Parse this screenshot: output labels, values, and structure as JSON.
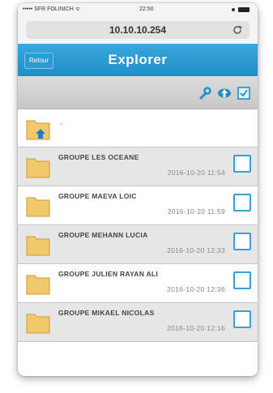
{
  "status_bar": {
    "carrier": "••••• SFR FOLINICH ᯤ",
    "time": "22:50",
    "battery_icon": "battery-icon"
  },
  "browser": {
    "url": "10.10.10.254",
    "reload_icon": "reload-icon"
  },
  "navbar": {
    "back_label": "Retour",
    "title": "Explorer"
  },
  "toolbar": {
    "icons": [
      "wrench-icon",
      "upload-icon",
      "select-all-icon"
    ]
  },
  "parent_row": {
    "label": "-",
    "icon": "folder-up-icon"
  },
  "rows": [
    {
      "name": "GROUPE LES OCEANE",
      "date": "2016-10-20 11:54"
    },
    {
      "name": "GROUPE MAEVA LOIC",
      "date": "2016-10-20 11:59"
    },
    {
      "name": "GROUPE MEHANN LUCIA",
      "date": "2016-10-20 12:33"
    },
    {
      "name": "GROUPE JULIEN RAYAN ALI",
      "date": "2016-10-20 12:36"
    },
    {
      "name": "GROUPE MIKAEL NICOLAS",
      "date": "2016-10-20 12:16"
    }
  ],
  "colors": {
    "navbar": "#2a9bd3",
    "checkbox_border": "#3a9fd6",
    "folder": "#f2c96a"
  }
}
